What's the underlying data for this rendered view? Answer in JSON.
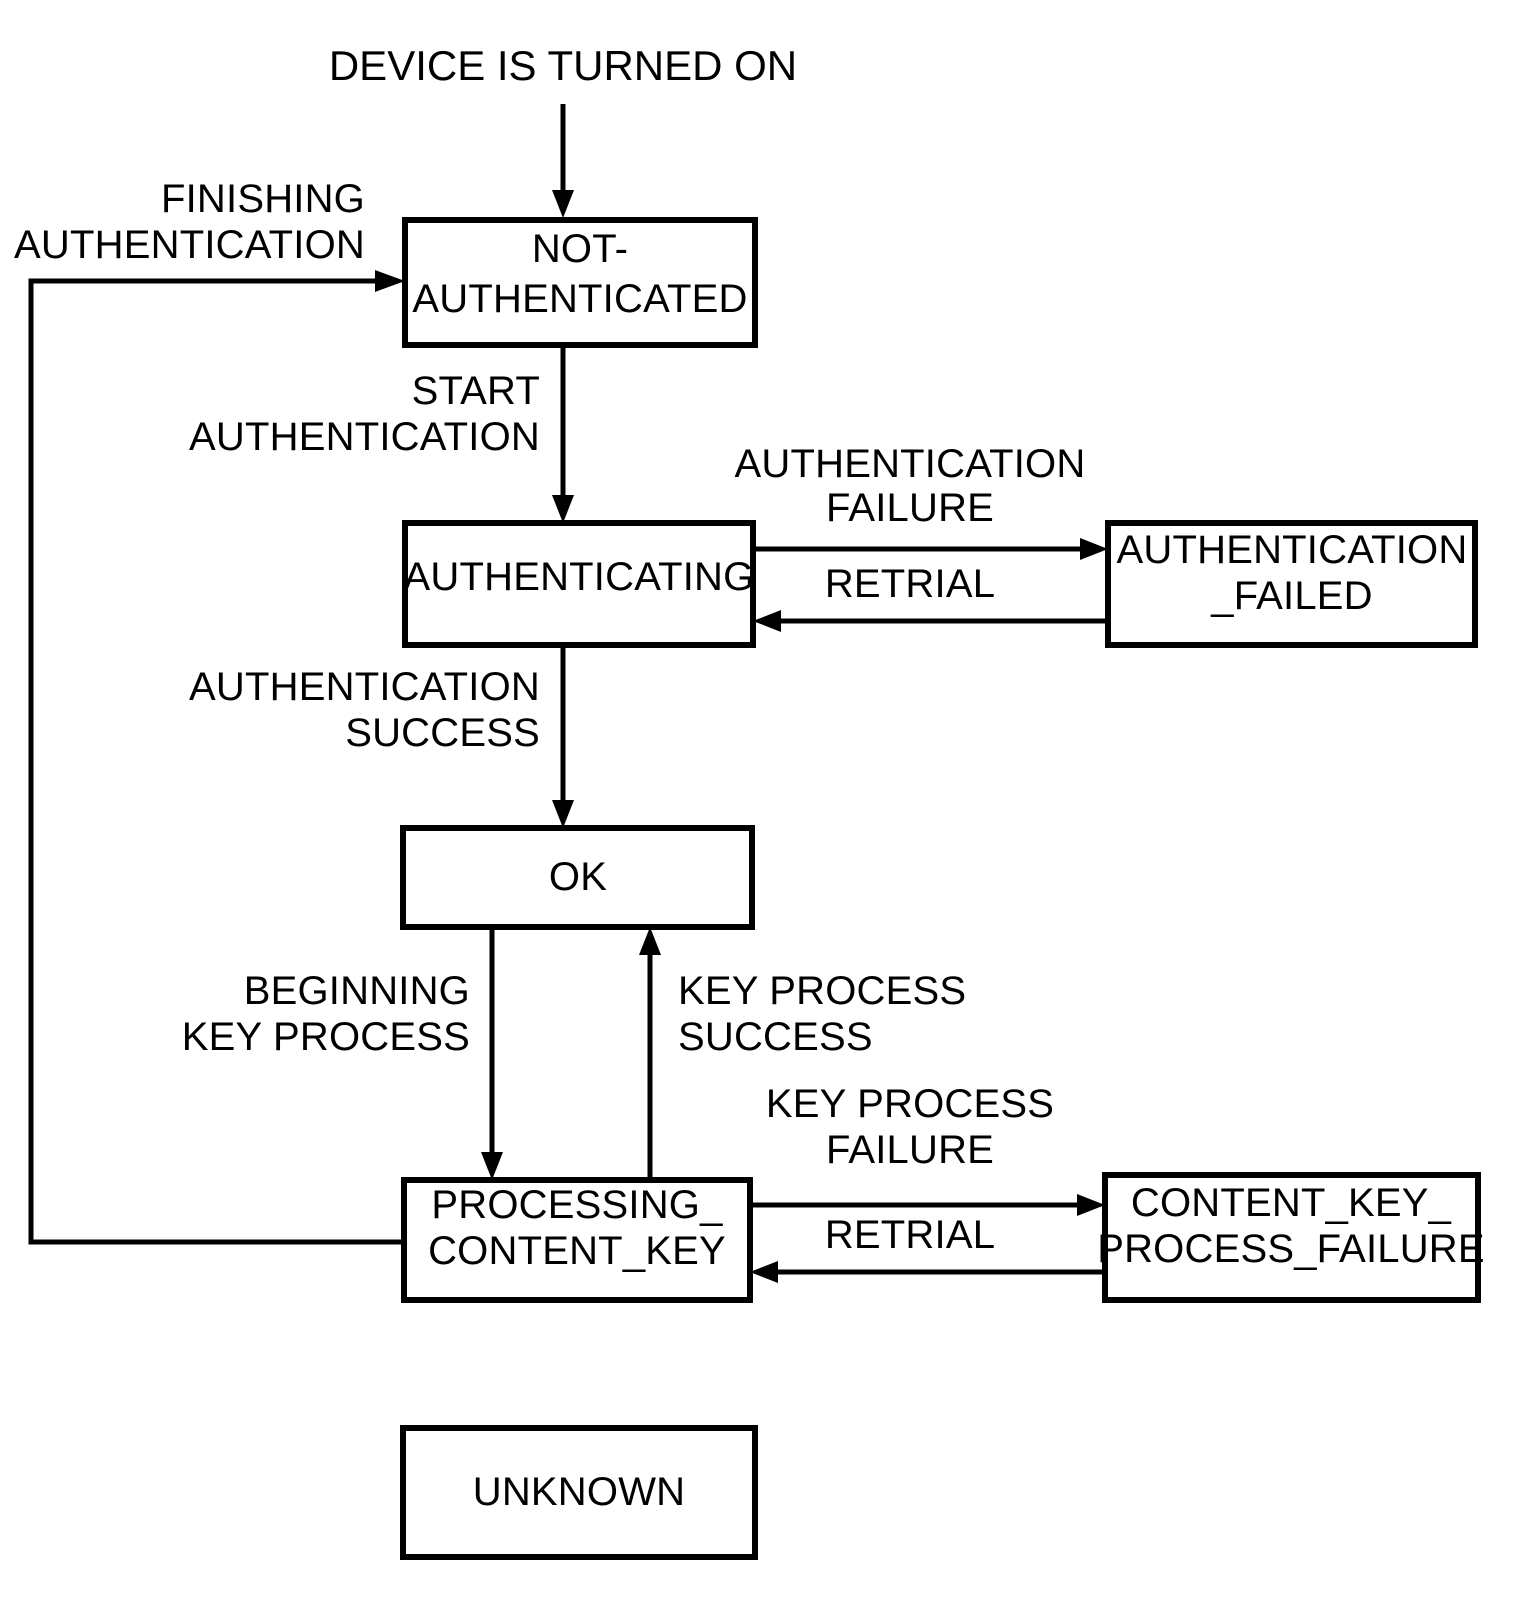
{
  "diagram": {
    "title": "DEVICE IS TURNED ON",
    "type": "state-transition-diagram",
    "states": [
      {
        "id": "not_authenticated",
        "label_line1": "NOT-",
        "label_line2": "AUTHENTICATED"
      },
      {
        "id": "authenticating",
        "label_line1": "AUTHENTICATING",
        "label_line2": ""
      },
      {
        "id": "authentication_failed",
        "label_line1": "AUTHENTICATION",
        "label_line2": "_FAILED"
      },
      {
        "id": "ok",
        "label_line1": "OK",
        "label_line2": ""
      },
      {
        "id": "processing_content_key",
        "label_line1": "PROCESSING_",
        "label_line2": "CONTENT_KEY"
      },
      {
        "id": "content_key_process_failure",
        "label_line1": "CONTENT_KEY_",
        "label_line2": "PROCESS_FAILURE"
      },
      {
        "id": "unknown",
        "label_line1": "UNKNOWN",
        "label_line2": ""
      }
    ],
    "transitions": [
      {
        "id": "t_start_on",
        "from": "",
        "to": "not_authenticated",
        "label_line1": "",
        "label_line2": ""
      },
      {
        "id": "t_finishing_auth",
        "from": "processing_content_key",
        "to": "not_authenticated",
        "label_line1": "FINISHING",
        "label_line2": "AUTHENTICATION"
      },
      {
        "id": "t_start_auth",
        "from": "not_authenticated",
        "to": "authenticating",
        "label_line1": "START",
        "label_line2": "AUTHENTICATION"
      },
      {
        "id": "t_auth_failure",
        "from": "authenticating",
        "to": "authentication_failed",
        "label_line1": "AUTHENTICATION",
        "label_line2": "FAILURE"
      },
      {
        "id": "t_auth_retrial",
        "from": "authentication_failed",
        "to": "authenticating",
        "label_line1": "RETRIAL",
        "label_line2": ""
      },
      {
        "id": "t_auth_success",
        "from": "authenticating",
        "to": "ok",
        "label_line1": "AUTHENTICATION",
        "label_line2": "SUCCESS"
      },
      {
        "id": "t_begin_key",
        "from": "ok",
        "to": "processing_content_key",
        "label_line1": "BEGINNING",
        "label_line2": "KEY PROCESS"
      },
      {
        "id": "t_key_success",
        "from": "processing_content_key",
        "to": "ok",
        "label_line1": "KEY PROCESS",
        "label_line2": "SUCCESS"
      },
      {
        "id": "t_key_failure",
        "from": "processing_content_key",
        "to": "content_key_process_failure",
        "label_line1": "KEY PROCESS",
        "label_line2": "FAILURE"
      },
      {
        "id": "t_key_retrial",
        "from": "content_key_process_failure",
        "to": "processing_content_key",
        "label_line1": "RETRIAL",
        "label_line2": ""
      }
    ],
    "colors": {
      "stroke": "#000000",
      "fill": "#ffffff",
      "text": "#000000"
    }
  }
}
